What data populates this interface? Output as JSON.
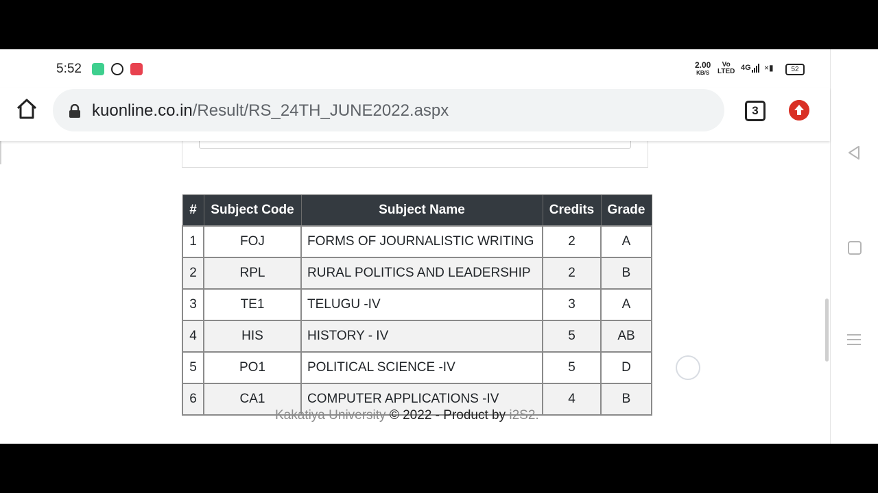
{
  "status_bar": {
    "time": "5:52",
    "speed_value": "2.00",
    "speed_unit": "KB/S",
    "volte_top": "Vo",
    "volte_bottom": "LTED",
    "network": "4G",
    "battery": "52"
  },
  "browser": {
    "url_host": "kuonline.co.in",
    "url_path": "/Result/RS_24TH_JUNE2022.aspx",
    "tab_count": "3"
  },
  "results_table": {
    "headers": {
      "num": "#",
      "code": "Subject Code",
      "name": "Subject Name",
      "credits": "Credits",
      "grade": "Grade"
    },
    "rows": [
      {
        "num": "1",
        "code": "FOJ",
        "name": "FORMS OF JOURNALISTIC WRITING",
        "credits": "2",
        "grade": "A"
      },
      {
        "num": "2",
        "code": "RPL",
        "name": "RURAL POLITICS AND LEADERSHIP",
        "credits": "2",
        "grade": "B"
      },
      {
        "num": "3",
        "code": "TE1",
        "name": "TELUGU -IV",
        "credits": "3",
        "grade": "A"
      },
      {
        "num": "4",
        "code": "HIS",
        "name": "HISTORY - IV",
        "credits": "5",
        "grade": "AB"
      },
      {
        "num": "5",
        "code": "PO1",
        "name": "POLITICAL SCIENCE -IV",
        "credits": "5",
        "grade": "D"
      },
      {
        "num": "6",
        "code": "CA1",
        "name": "COMPUTER APPLICATIONS -IV",
        "credits": "4",
        "grade": "B"
      }
    ]
  },
  "footer": {
    "university_link": "Kakatiya University",
    "copyright": " © 2022 - Product by ",
    "vendor_link": "i2S2."
  }
}
